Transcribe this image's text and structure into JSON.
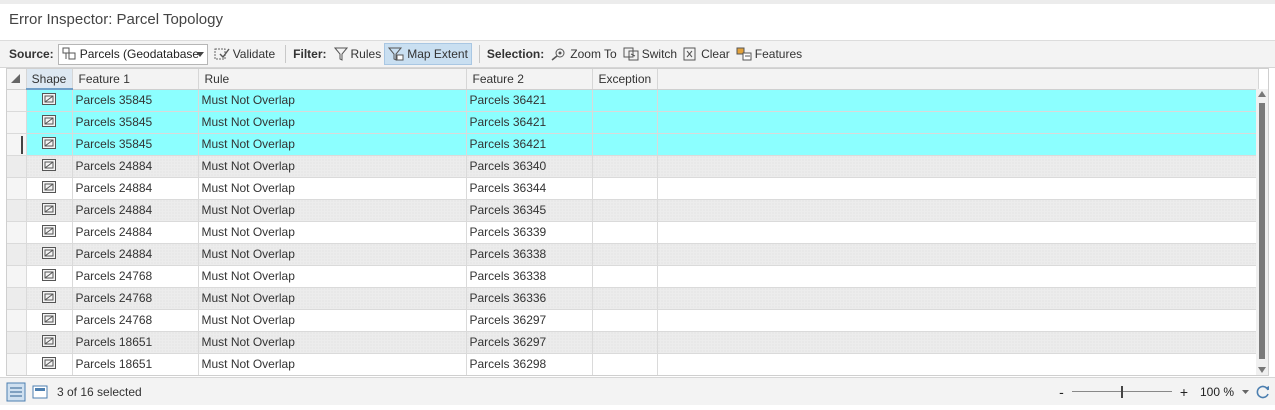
{
  "window": {
    "title": "Error Inspector: Parcel Topology"
  },
  "toolbar": {
    "source_label": "Source:",
    "source_value": "Parcels (Geodatabase",
    "validate_label": "Validate",
    "filter_label": "Filter:",
    "rules_label": "Rules",
    "map_extent_label": "Map Extent",
    "selection_label": "Selection:",
    "zoom_to_label": "Zoom To",
    "switch_label": "Switch",
    "clear_label": "Clear",
    "features_label": "Features"
  },
  "table": {
    "columns": [
      "Shape",
      "Feature 1",
      "Rule",
      "Feature 2",
      "Exception"
    ],
    "rows": [
      {
        "feature1": "Parcels 35845",
        "rule": "Must Not Overlap",
        "feature2": "Parcels 36421",
        "exception": "",
        "selected": true
      },
      {
        "feature1": "Parcels 35845",
        "rule": "Must Not Overlap",
        "feature2": "Parcels 36421",
        "exception": "",
        "selected": true
      },
      {
        "feature1": "Parcels 35845",
        "rule": "Must Not Overlap",
        "feature2": "Parcels 36421",
        "exception": "",
        "selected": true,
        "current": true
      },
      {
        "feature1": "Parcels 24884",
        "rule": "Must Not Overlap",
        "feature2": "Parcels 36340",
        "exception": "",
        "selected": false
      },
      {
        "feature1": "Parcels 24884",
        "rule": "Must Not Overlap",
        "feature2": "Parcels 36344",
        "exception": "",
        "selected": false
      },
      {
        "feature1": "Parcels 24884",
        "rule": "Must Not Overlap",
        "feature2": "Parcels 36345",
        "exception": "",
        "selected": false
      },
      {
        "feature1": "Parcels 24884",
        "rule": "Must Not Overlap",
        "feature2": "Parcels 36339",
        "exception": "",
        "selected": false
      },
      {
        "feature1": "Parcels 24884",
        "rule": "Must Not Overlap",
        "feature2": "Parcels 36338",
        "exception": "",
        "selected": false
      },
      {
        "feature1": "Parcels 24768",
        "rule": "Must Not Overlap",
        "feature2": "Parcels 36338",
        "exception": "",
        "selected": false
      },
      {
        "feature1": "Parcels 24768",
        "rule": "Must Not Overlap",
        "feature2": "Parcels 36336",
        "exception": "",
        "selected": false
      },
      {
        "feature1": "Parcels 24768",
        "rule": "Must Not Overlap",
        "feature2": "Parcels 36297",
        "exception": "",
        "selected": false
      },
      {
        "feature1": "Parcels 18651",
        "rule": "Must Not Overlap",
        "feature2": "Parcels 36297",
        "exception": "",
        "selected": false
      },
      {
        "feature1": "Parcels 18651",
        "rule": "Must Not Overlap",
        "feature2": "Parcels 36298",
        "exception": "",
        "selected": false
      }
    ]
  },
  "status": {
    "selection_text": "3 of 16 selected",
    "zoom_minus": "-",
    "zoom_plus": "+",
    "zoom_value": "100 %",
    "zoom_level": 0.5
  },
  "colors": {
    "selected_row": "#8cffff",
    "active_button": "#c9dff1"
  }
}
